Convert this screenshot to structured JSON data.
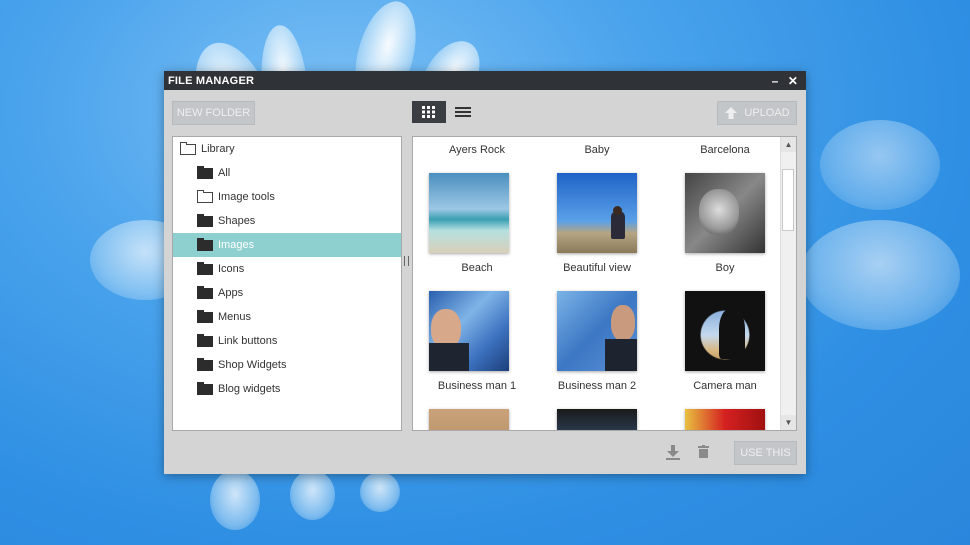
{
  "window": {
    "title": "FILE MANAGER",
    "minimize_glyph": "–",
    "close_glyph": "✕"
  },
  "toolbar": {
    "new_folder_label": "NEW FOLDER",
    "upload_label": "UPLOAD",
    "grid_view_icon": "grid-icon",
    "list_view_icon": "list-icon"
  },
  "tree": {
    "root": "Library",
    "items": [
      {
        "label": "All",
        "icon": "folder-filled"
      },
      {
        "label": "Image tools",
        "icon": "folder-outline"
      },
      {
        "label": "Shapes",
        "icon": "folder-filled"
      },
      {
        "label": "Images",
        "icon": "folder-filled",
        "selected": true
      },
      {
        "label": "Icons",
        "icon": "folder-filled"
      },
      {
        "label": "Apps",
        "icon": "folder-filled"
      },
      {
        "label": "Menus",
        "icon": "folder-filled"
      },
      {
        "label": "Link buttons",
        "icon": "folder-filled"
      },
      {
        "label": "Shop Widgets",
        "icon": "folder-filled"
      },
      {
        "label": "Blog widgets",
        "icon": "folder-filled"
      }
    ]
  },
  "gallery": {
    "top_labels": [
      "Ayers Rock",
      "Baby",
      "Barcelona"
    ],
    "row1": [
      "Beach",
      "Beautiful view",
      "Boy"
    ],
    "row2": [
      "Business man 1",
      "Business man 2",
      "Camera man"
    ]
  },
  "footer": {
    "use_this_label": "USE THIS",
    "download_icon": "download-icon",
    "trash_icon": "trash-icon"
  }
}
